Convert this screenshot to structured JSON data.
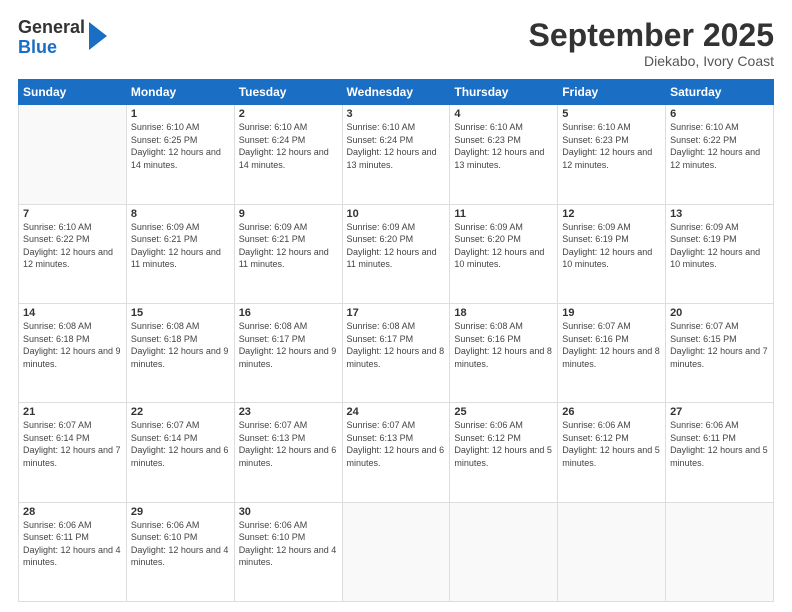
{
  "logo": {
    "line1": "General",
    "line2": "Blue"
  },
  "title": "September 2025",
  "subtitle": "Diekabo, Ivory Coast",
  "weekdays": [
    "Sunday",
    "Monday",
    "Tuesday",
    "Wednesday",
    "Thursday",
    "Friday",
    "Saturday"
  ],
  "weeks": [
    [
      {
        "day": "",
        "sunrise": "",
        "sunset": "",
        "daylight": ""
      },
      {
        "day": "1",
        "sunrise": "Sunrise: 6:10 AM",
        "sunset": "Sunset: 6:25 PM",
        "daylight": "Daylight: 12 hours and 14 minutes."
      },
      {
        "day": "2",
        "sunrise": "Sunrise: 6:10 AM",
        "sunset": "Sunset: 6:24 PM",
        "daylight": "Daylight: 12 hours and 14 minutes."
      },
      {
        "day": "3",
        "sunrise": "Sunrise: 6:10 AM",
        "sunset": "Sunset: 6:24 PM",
        "daylight": "Daylight: 12 hours and 13 minutes."
      },
      {
        "day": "4",
        "sunrise": "Sunrise: 6:10 AM",
        "sunset": "Sunset: 6:23 PM",
        "daylight": "Daylight: 12 hours and 13 minutes."
      },
      {
        "day": "5",
        "sunrise": "Sunrise: 6:10 AM",
        "sunset": "Sunset: 6:23 PM",
        "daylight": "Daylight: 12 hours and 12 minutes."
      },
      {
        "day": "6",
        "sunrise": "Sunrise: 6:10 AM",
        "sunset": "Sunset: 6:22 PM",
        "daylight": "Daylight: 12 hours and 12 minutes."
      }
    ],
    [
      {
        "day": "7",
        "sunrise": "Sunrise: 6:10 AM",
        "sunset": "Sunset: 6:22 PM",
        "daylight": "Daylight: 12 hours and 12 minutes."
      },
      {
        "day": "8",
        "sunrise": "Sunrise: 6:09 AM",
        "sunset": "Sunset: 6:21 PM",
        "daylight": "Daylight: 12 hours and 11 minutes."
      },
      {
        "day": "9",
        "sunrise": "Sunrise: 6:09 AM",
        "sunset": "Sunset: 6:21 PM",
        "daylight": "Daylight: 12 hours and 11 minutes."
      },
      {
        "day": "10",
        "sunrise": "Sunrise: 6:09 AM",
        "sunset": "Sunset: 6:20 PM",
        "daylight": "Daylight: 12 hours and 11 minutes."
      },
      {
        "day": "11",
        "sunrise": "Sunrise: 6:09 AM",
        "sunset": "Sunset: 6:20 PM",
        "daylight": "Daylight: 12 hours and 10 minutes."
      },
      {
        "day": "12",
        "sunrise": "Sunrise: 6:09 AM",
        "sunset": "Sunset: 6:19 PM",
        "daylight": "Daylight: 12 hours and 10 minutes."
      },
      {
        "day": "13",
        "sunrise": "Sunrise: 6:09 AM",
        "sunset": "Sunset: 6:19 PM",
        "daylight": "Daylight: 12 hours and 10 minutes."
      }
    ],
    [
      {
        "day": "14",
        "sunrise": "Sunrise: 6:08 AM",
        "sunset": "Sunset: 6:18 PM",
        "daylight": "Daylight: 12 hours and 9 minutes."
      },
      {
        "day": "15",
        "sunrise": "Sunrise: 6:08 AM",
        "sunset": "Sunset: 6:18 PM",
        "daylight": "Daylight: 12 hours and 9 minutes."
      },
      {
        "day": "16",
        "sunrise": "Sunrise: 6:08 AM",
        "sunset": "Sunset: 6:17 PM",
        "daylight": "Daylight: 12 hours and 9 minutes."
      },
      {
        "day": "17",
        "sunrise": "Sunrise: 6:08 AM",
        "sunset": "Sunset: 6:17 PM",
        "daylight": "Daylight: 12 hours and 8 minutes."
      },
      {
        "day": "18",
        "sunrise": "Sunrise: 6:08 AM",
        "sunset": "Sunset: 6:16 PM",
        "daylight": "Daylight: 12 hours and 8 minutes."
      },
      {
        "day": "19",
        "sunrise": "Sunrise: 6:07 AM",
        "sunset": "Sunset: 6:16 PM",
        "daylight": "Daylight: 12 hours and 8 minutes."
      },
      {
        "day": "20",
        "sunrise": "Sunrise: 6:07 AM",
        "sunset": "Sunset: 6:15 PM",
        "daylight": "Daylight: 12 hours and 7 minutes."
      }
    ],
    [
      {
        "day": "21",
        "sunrise": "Sunrise: 6:07 AM",
        "sunset": "Sunset: 6:14 PM",
        "daylight": "Daylight: 12 hours and 7 minutes."
      },
      {
        "day": "22",
        "sunrise": "Sunrise: 6:07 AM",
        "sunset": "Sunset: 6:14 PM",
        "daylight": "Daylight: 12 hours and 6 minutes."
      },
      {
        "day": "23",
        "sunrise": "Sunrise: 6:07 AM",
        "sunset": "Sunset: 6:13 PM",
        "daylight": "Daylight: 12 hours and 6 minutes."
      },
      {
        "day": "24",
        "sunrise": "Sunrise: 6:07 AM",
        "sunset": "Sunset: 6:13 PM",
        "daylight": "Daylight: 12 hours and 6 minutes."
      },
      {
        "day": "25",
        "sunrise": "Sunrise: 6:06 AM",
        "sunset": "Sunset: 6:12 PM",
        "daylight": "Daylight: 12 hours and 5 minutes."
      },
      {
        "day": "26",
        "sunrise": "Sunrise: 6:06 AM",
        "sunset": "Sunset: 6:12 PM",
        "daylight": "Daylight: 12 hours and 5 minutes."
      },
      {
        "day": "27",
        "sunrise": "Sunrise: 6:06 AM",
        "sunset": "Sunset: 6:11 PM",
        "daylight": "Daylight: 12 hours and 5 minutes."
      }
    ],
    [
      {
        "day": "28",
        "sunrise": "Sunrise: 6:06 AM",
        "sunset": "Sunset: 6:11 PM",
        "daylight": "Daylight: 12 hours and 4 minutes."
      },
      {
        "day": "29",
        "sunrise": "Sunrise: 6:06 AM",
        "sunset": "Sunset: 6:10 PM",
        "daylight": "Daylight: 12 hours and 4 minutes."
      },
      {
        "day": "30",
        "sunrise": "Sunrise: 6:06 AM",
        "sunset": "Sunset: 6:10 PM",
        "daylight": "Daylight: 12 hours and 4 minutes."
      },
      {
        "day": "",
        "sunrise": "",
        "sunset": "",
        "daylight": ""
      },
      {
        "day": "",
        "sunrise": "",
        "sunset": "",
        "daylight": ""
      },
      {
        "day": "",
        "sunrise": "",
        "sunset": "",
        "daylight": ""
      },
      {
        "day": "",
        "sunrise": "",
        "sunset": "",
        "daylight": ""
      }
    ]
  ]
}
